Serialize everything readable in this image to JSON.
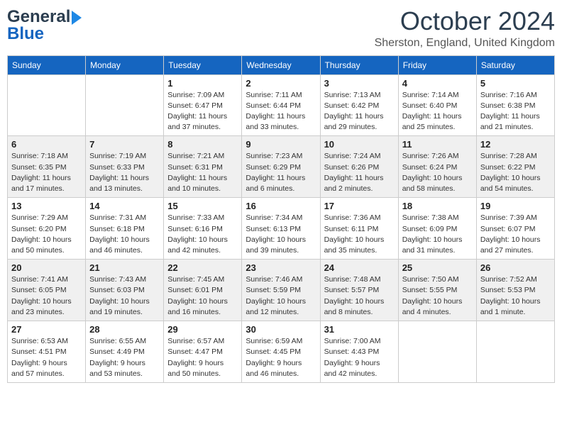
{
  "header": {
    "logo_line1": "General",
    "logo_line2": "Blue",
    "month": "October 2024",
    "location": "Sherston, England, United Kingdom"
  },
  "days_of_week": [
    "Sunday",
    "Monday",
    "Tuesday",
    "Wednesday",
    "Thursday",
    "Friday",
    "Saturday"
  ],
  "weeks": [
    [
      {
        "day": "",
        "sunrise": "",
        "sunset": "",
        "daylight": ""
      },
      {
        "day": "",
        "sunrise": "",
        "sunset": "",
        "daylight": ""
      },
      {
        "day": "1",
        "sunrise": "Sunrise: 7:09 AM",
        "sunset": "Sunset: 6:47 PM",
        "daylight": "Daylight: 11 hours and 37 minutes."
      },
      {
        "day": "2",
        "sunrise": "Sunrise: 7:11 AM",
        "sunset": "Sunset: 6:44 PM",
        "daylight": "Daylight: 11 hours and 33 minutes."
      },
      {
        "day": "3",
        "sunrise": "Sunrise: 7:13 AM",
        "sunset": "Sunset: 6:42 PM",
        "daylight": "Daylight: 11 hours and 29 minutes."
      },
      {
        "day": "4",
        "sunrise": "Sunrise: 7:14 AM",
        "sunset": "Sunset: 6:40 PM",
        "daylight": "Daylight: 11 hours and 25 minutes."
      },
      {
        "day": "5",
        "sunrise": "Sunrise: 7:16 AM",
        "sunset": "Sunset: 6:38 PM",
        "daylight": "Daylight: 11 hours and 21 minutes."
      }
    ],
    [
      {
        "day": "6",
        "sunrise": "Sunrise: 7:18 AM",
        "sunset": "Sunset: 6:35 PM",
        "daylight": "Daylight: 11 hours and 17 minutes."
      },
      {
        "day": "7",
        "sunrise": "Sunrise: 7:19 AM",
        "sunset": "Sunset: 6:33 PM",
        "daylight": "Daylight: 11 hours and 13 minutes."
      },
      {
        "day": "8",
        "sunrise": "Sunrise: 7:21 AM",
        "sunset": "Sunset: 6:31 PM",
        "daylight": "Daylight: 11 hours and 10 minutes."
      },
      {
        "day": "9",
        "sunrise": "Sunrise: 7:23 AM",
        "sunset": "Sunset: 6:29 PM",
        "daylight": "Daylight: 11 hours and 6 minutes."
      },
      {
        "day": "10",
        "sunrise": "Sunrise: 7:24 AM",
        "sunset": "Sunset: 6:26 PM",
        "daylight": "Daylight: 11 hours and 2 minutes."
      },
      {
        "day": "11",
        "sunrise": "Sunrise: 7:26 AM",
        "sunset": "Sunset: 6:24 PM",
        "daylight": "Daylight: 10 hours and 58 minutes."
      },
      {
        "day": "12",
        "sunrise": "Sunrise: 7:28 AM",
        "sunset": "Sunset: 6:22 PM",
        "daylight": "Daylight: 10 hours and 54 minutes."
      }
    ],
    [
      {
        "day": "13",
        "sunrise": "Sunrise: 7:29 AM",
        "sunset": "Sunset: 6:20 PM",
        "daylight": "Daylight: 10 hours and 50 minutes."
      },
      {
        "day": "14",
        "sunrise": "Sunrise: 7:31 AM",
        "sunset": "Sunset: 6:18 PM",
        "daylight": "Daylight: 10 hours and 46 minutes."
      },
      {
        "day": "15",
        "sunrise": "Sunrise: 7:33 AM",
        "sunset": "Sunset: 6:16 PM",
        "daylight": "Daylight: 10 hours and 42 minutes."
      },
      {
        "day": "16",
        "sunrise": "Sunrise: 7:34 AM",
        "sunset": "Sunset: 6:13 PM",
        "daylight": "Daylight: 10 hours and 39 minutes."
      },
      {
        "day": "17",
        "sunrise": "Sunrise: 7:36 AM",
        "sunset": "Sunset: 6:11 PM",
        "daylight": "Daylight: 10 hours and 35 minutes."
      },
      {
        "day": "18",
        "sunrise": "Sunrise: 7:38 AM",
        "sunset": "Sunset: 6:09 PM",
        "daylight": "Daylight: 10 hours and 31 minutes."
      },
      {
        "day": "19",
        "sunrise": "Sunrise: 7:39 AM",
        "sunset": "Sunset: 6:07 PM",
        "daylight": "Daylight: 10 hours and 27 minutes."
      }
    ],
    [
      {
        "day": "20",
        "sunrise": "Sunrise: 7:41 AM",
        "sunset": "Sunset: 6:05 PM",
        "daylight": "Daylight: 10 hours and 23 minutes."
      },
      {
        "day": "21",
        "sunrise": "Sunrise: 7:43 AM",
        "sunset": "Sunset: 6:03 PM",
        "daylight": "Daylight: 10 hours and 19 minutes."
      },
      {
        "day": "22",
        "sunrise": "Sunrise: 7:45 AM",
        "sunset": "Sunset: 6:01 PM",
        "daylight": "Daylight: 10 hours and 16 minutes."
      },
      {
        "day": "23",
        "sunrise": "Sunrise: 7:46 AM",
        "sunset": "Sunset: 5:59 PM",
        "daylight": "Daylight: 10 hours and 12 minutes."
      },
      {
        "day": "24",
        "sunrise": "Sunrise: 7:48 AM",
        "sunset": "Sunset: 5:57 PM",
        "daylight": "Daylight: 10 hours and 8 minutes."
      },
      {
        "day": "25",
        "sunrise": "Sunrise: 7:50 AM",
        "sunset": "Sunset: 5:55 PM",
        "daylight": "Daylight: 10 hours and 4 minutes."
      },
      {
        "day": "26",
        "sunrise": "Sunrise: 7:52 AM",
        "sunset": "Sunset: 5:53 PM",
        "daylight": "Daylight: 10 hours and 1 minute."
      }
    ],
    [
      {
        "day": "27",
        "sunrise": "Sunrise: 6:53 AM",
        "sunset": "Sunset: 4:51 PM",
        "daylight": "Daylight: 9 hours and 57 minutes."
      },
      {
        "day": "28",
        "sunrise": "Sunrise: 6:55 AM",
        "sunset": "Sunset: 4:49 PM",
        "daylight": "Daylight: 9 hours and 53 minutes."
      },
      {
        "day": "29",
        "sunrise": "Sunrise: 6:57 AM",
        "sunset": "Sunset: 4:47 PM",
        "daylight": "Daylight: 9 hours and 50 minutes."
      },
      {
        "day": "30",
        "sunrise": "Sunrise: 6:59 AM",
        "sunset": "Sunset: 4:45 PM",
        "daylight": "Daylight: 9 hours and 46 minutes."
      },
      {
        "day": "31",
        "sunrise": "Sunrise: 7:00 AM",
        "sunset": "Sunset: 4:43 PM",
        "daylight": "Daylight: 9 hours and 42 minutes."
      },
      {
        "day": "",
        "sunrise": "",
        "sunset": "",
        "daylight": ""
      },
      {
        "day": "",
        "sunrise": "",
        "sunset": "",
        "daylight": ""
      }
    ]
  ]
}
